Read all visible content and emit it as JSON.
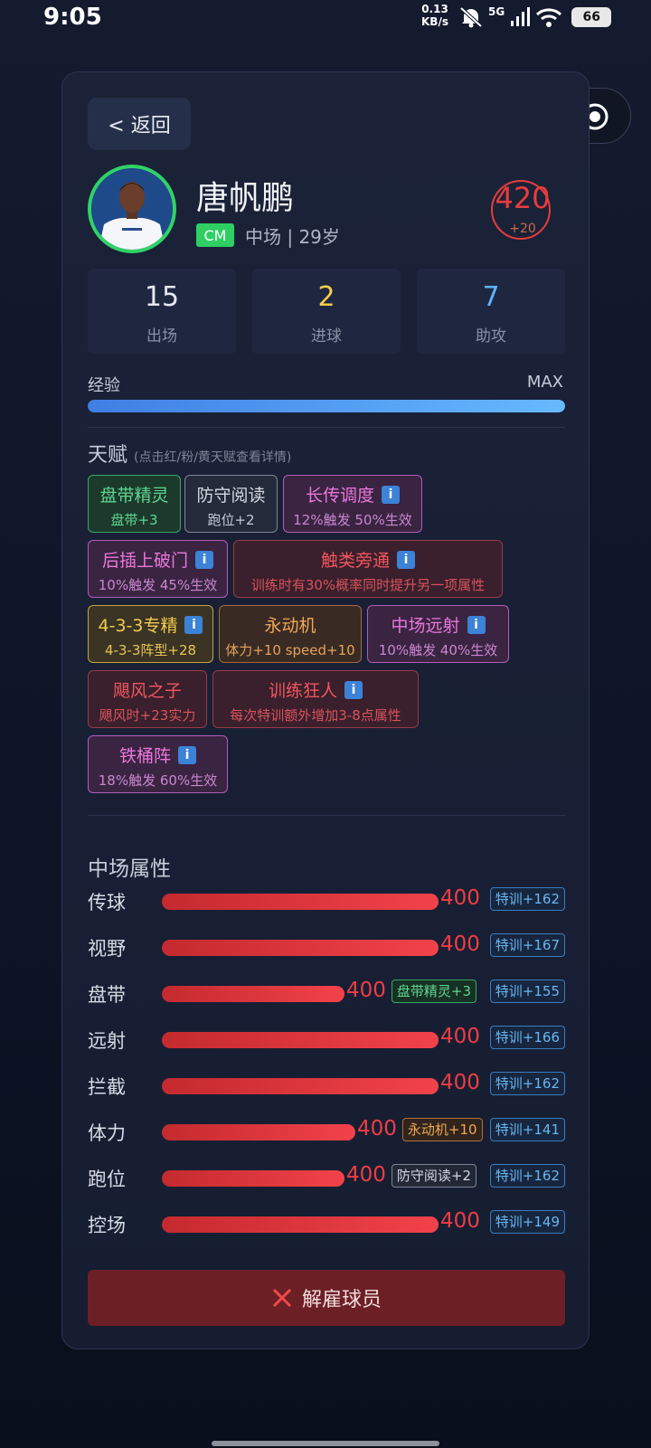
{
  "status_bar": {
    "time": "9:05",
    "net_speed": "0.13",
    "net_unit": "KB/s",
    "network": "5G",
    "battery": "66"
  },
  "nav": {
    "back_label": "< 返回"
  },
  "player": {
    "name": "唐帆鹏",
    "position": "CM",
    "position_info": "中场 | 29岁",
    "rating": "420",
    "rating_bonus": "+20"
  },
  "stats": [
    {
      "value": "15",
      "label": "出场",
      "color": "#e6e9f2"
    },
    {
      "value": "2",
      "label": "进球",
      "color": "#f5cf4b"
    },
    {
      "value": "7",
      "label": "助攻",
      "color": "#5fb3ff"
    }
  ],
  "experience": {
    "label": "经验",
    "max_label": "MAX",
    "progress": 1.0
  },
  "talents": {
    "title": "天赋",
    "hint": "(点击红/粉/黄天赋查看详情)",
    "info_symbol": "i",
    "items": [
      {
        "name": "盘带精灵",
        "desc": "盘带+3",
        "style": "green",
        "info": false
      },
      {
        "name": "防守阅读",
        "desc": "跑位+2",
        "style": "gray",
        "info": false
      },
      {
        "name": "长传调度",
        "desc": "12%触发 50%生效",
        "style": "pink",
        "info": true
      },
      {
        "name": "后插上破门",
        "desc": "10%触发 45%生效",
        "style": "pink",
        "info": true
      },
      {
        "name": "触类旁通",
        "desc": "训练时有30%概率同时提升另一项属性",
        "style": "red",
        "info": true
      },
      {
        "name": "4-3-3专精",
        "desc": "4-3-3阵型+28",
        "style": "yellow",
        "info": true
      },
      {
        "name": "永动机",
        "desc": "体力+10 speed+10",
        "style": "orange",
        "info": false
      },
      {
        "name": "中场远射",
        "desc": "10%触发 40%生效",
        "style": "pink",
        "info": true
      },
      {
        "name": "飓风之子",
        "desc": "飓风时+23实力",
        "style": "red",
        "info": false
      },
      {
        "name": "训练狂人",
        "desc": "每次特训额外增加3-8点属性",
        "style": "red",
        "info": true
      },
      {
        "name": "铁桶阵",
        "desc": "18%触发 60%生效",
        "style": "pink",
        "info": true
      }
    ]
  },
  "attributes": {
    "title": "中场属性",
    "items": [
      {
        "label": "传球",
        "value": "400",
        "bar_fill": 1.0,
        "bonus": null,
        "train": "特训+162"
      },
      {
        "label": "视野",
        "value": "400",
        "bar_fill": 1.0,
        "bonus": null,
        "train": "特训+167"
      },
      {
        "label": "盘带",
        "value": "400",
        "bar_fill": 0.66,
        "bonus": {
          "text": "盘带精灵+3",
          "style": "green"
        },
        "train": "特训+155"
      },
      {
        "label": "远射",
        "value": "400",
        "bar_fill": 1.0,
        "bonus": null,
        "train": "特训+166"
      },
      {
        "label": "拦截",
        "value": "400",
        "bar_fill": 1.0,
        "bonus": null,
        "train": "特训+162"
      },
      {
        "label": "体力",
        "value": "400",
        "bar_fill": 0.7,
        "bonus": {
          "text": "永动机+10",
          "style": "orange"
        },
        "train": "特训+141"
      },
      {
        "label": "跑位",
        "value": "400",
        "bar_fill": 0.66,
        "bonus": {
          "text": "防守阅读+2",
          "style": "gray"
        },
        "train": "特训+162"
      },
      {
        "label": "控场",
        "value": "400",
        "bar_fill": 1.0,
        "bonus": null,
        "train": "特训+149"
      }
    ]
  },
  "actions": {
    "fire_label": "解雇球员"
  }
}
